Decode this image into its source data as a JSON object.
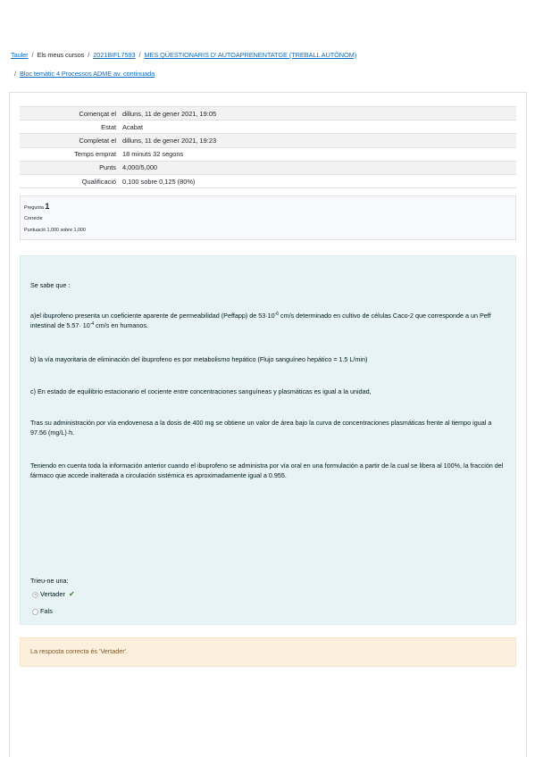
{
  "breadcrumb": {
    "home": "Tauler",
    "my_courses": "Els meus cursos",
    "course": "2021BIFL7593",
    "section": "MES QÜESTIONARIS D' AUTOAPRENENTATGE (TREBALL AUTÒNOM)",
    "quiz": "Bloc temàtic 4 Processos ADME av. continuada",
    "separator": "/"
  },
  "summary": {
    "rows": [
      {
        "label": "Començat el",
        "value": "dilluns, 11 de gener 2021, 19:05"
      },
      {
        "label": "Estat",
        "value": "Acabat"
      },
      {
        "label": "Completat el",
        "value": "dilluns, 11 de gener 2021, 19:23"
      },
      {
        "label": "Temps emprat",
        "value": "18 minuts 32 segons"
      },
      {
        "label": "Punts",
        "value": "4,000/5,000"
      },
      {
        "label": "Qualificació",
        "value": "0,100 sobre 0,125 (80%)"
      }
    ]
  },
  "question": {
    "label": "Pregunta",
    "number": "1",
    "state": "Correcte",
    "grade": "Puntuació 1,000 sobre 1,000",
    "intro": "Se sabe que :",
    "a_pre": "a)el ibuprofeno presenta un coeficiente aparente de permeabilidad (Peffapp) de 53·10",
    "a_exp1": "-6",
    "a_mid": " cm/s determinado en cultivo de células Caco-2 que corresponde a un Peff intestinal de 5.57· 10",
    "a_exp2": "-4",
    "a_post": " cm/s en humanos.",
    "b": "b) la vía mayoritaria de eliminación del ibuprofeno es por metabolismo hepático (Flujo sanguíneo hepático = 1.5 L/min)",
    "c": "c) En estado de equilibrio estacionario el cociente entre concentraciones sanguíneas y plasmáticas es igual a la unidad,",
    "d": "Tras su administración por vía endovenosa a la dosis de 400 mg se obtiene un valor de área bajo la curva de concentraciones plasmáticas frente al tiempo igual a 97.56 (mg/L)·h.",
    "e": "Teniendo en cuenta toda la información anterior cuando el ibuprofeno se administra por vía oral en una formulación a partir de la cual se libera al 100%, la fracción del fármaco que accede inalterada a circulación sistémica es aproximadamente igual a 0.955.",
    "prompt": "Trieu-ne una:",
    "options": [
      {
        "label": "Vertader",
        "selected": true,
        "correct": true
      },
      {
        "label": "Fals",
        "selected": false,
        "correct": false
      }
    ],
    "check_icon": "check-icon",
    "feedback": "La resposta correcta és 'Vertader'."
  },
  "colors": {
    "link": "#0f6cbf",
    "formulation_bg": "#e7f3f5",
    "feedback_bg": "#fcefdc",
    "feedback_text": "#7d5a29",
    "correct": "#357a32"
  }
}
